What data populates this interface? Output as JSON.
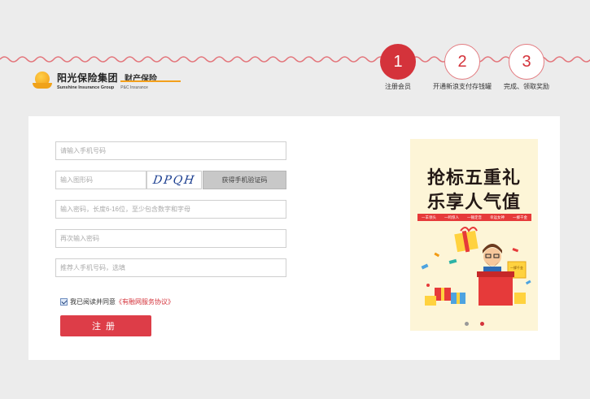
{
  "logo": {
    "cn": "阳光保险集团",
    "sub": "财产保险",
    "en": "Sunshine Insurance Group",
    "en_sub": "P&C Insurance"
  },
  "steps": [
    {
      "number": "1",
      "label": "注册会员",
      "active": true
    },
    {
      "number": "2",
      "label": "开通新浪支付存钱罐",
      "active": false
    },
    {
      "number": "3",
      "label": "完成、领取奖励",
      "active": false
    }
  ],
  "form": {
    "phone_placeholder": "请输入手机号码",
    "image_code_placeholder": "输入图形码",
    "captcha_text": "DPQH",
    "sms_button": "获得手机验证码",
    "password_placeholder": "输入密码，长度6-16位，至少包含数字和字母",
    "confirm_placeholder": "再次输入密码",
    "referrer_placeholder": "推荐人手机号码，选填",
    "agree_text": "我已阅读并同意",
    "agree_link": "《有融网服务协议》",
    "register_label": "注册"
  },
  "promo": {
    "line1": "抢标五重礼",
    "line2": "乐享人气值",
    "tags": [
      "一羊领头",
      "一鸣惊人",
      "一锤定音",
      "幸运女神",
      "一掷千金"
    ],
    "sign_text": "一掷千金"
  },
  "colors": {
    "accent": "#d4333b",
    "wave": "#e3747a",
    "background": "#ececec"
  }
}
